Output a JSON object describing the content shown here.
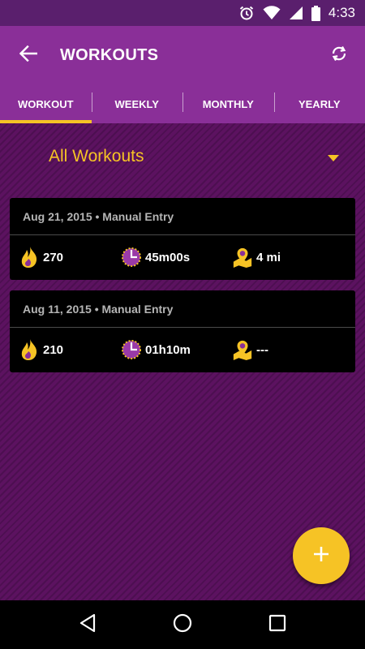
{
  "status_bar": {
    "time": "4:33",
    "icons": [
      "alarm-icon",
      "wifi-icon",
      "cellular-icon",
      "battery-icon"
    ]
  },
  "app_bar": {
    "title": "WORKOUTS",
    "back_icon": "arrow-left-icon",
    "sync_icon": "sync-icon"
  },
  "tabs": [
    {
      "label": "WORKOUT",
      "active": true
    },
    {
      "label": "WEEKLY",
      "active": false
    },
    {
      "label": "MONTHLY",
      "active": false
    },
    {
      "label": "YEARLY",
      "active": false
    }
  ],
  "filter": {
    "selected": "All Workouts",
    "icon": "chevron-down-icon"
  },
  "workouts": [
    {
      "date": "Aug 21, 2015",
      "source": "Manual Entry",
      "calories": "270",
      "duration": "45m00s",
      "distance": "4 mi"
    },
    {
      "date": "Aug 11, 2015",
      "source": "Manual Entry",
      "calories": "210",
      "duration": "01h10m",
      "distance": "---"
    }
  ],
  "fab": {
    "icon": "plus-icon"
  },
  "nav_bar": {
    "icons": [
      "back-triangle-icon",
      "home-circle-icon",
      "recents-square-icon"
    ]
  },
  "colors": {
    "accent": "#f6c325",
    "toolbar": "#8a2f98",
    "status_bar": "#5a1f6d",
    "background": "#5c1260"
  }
}
